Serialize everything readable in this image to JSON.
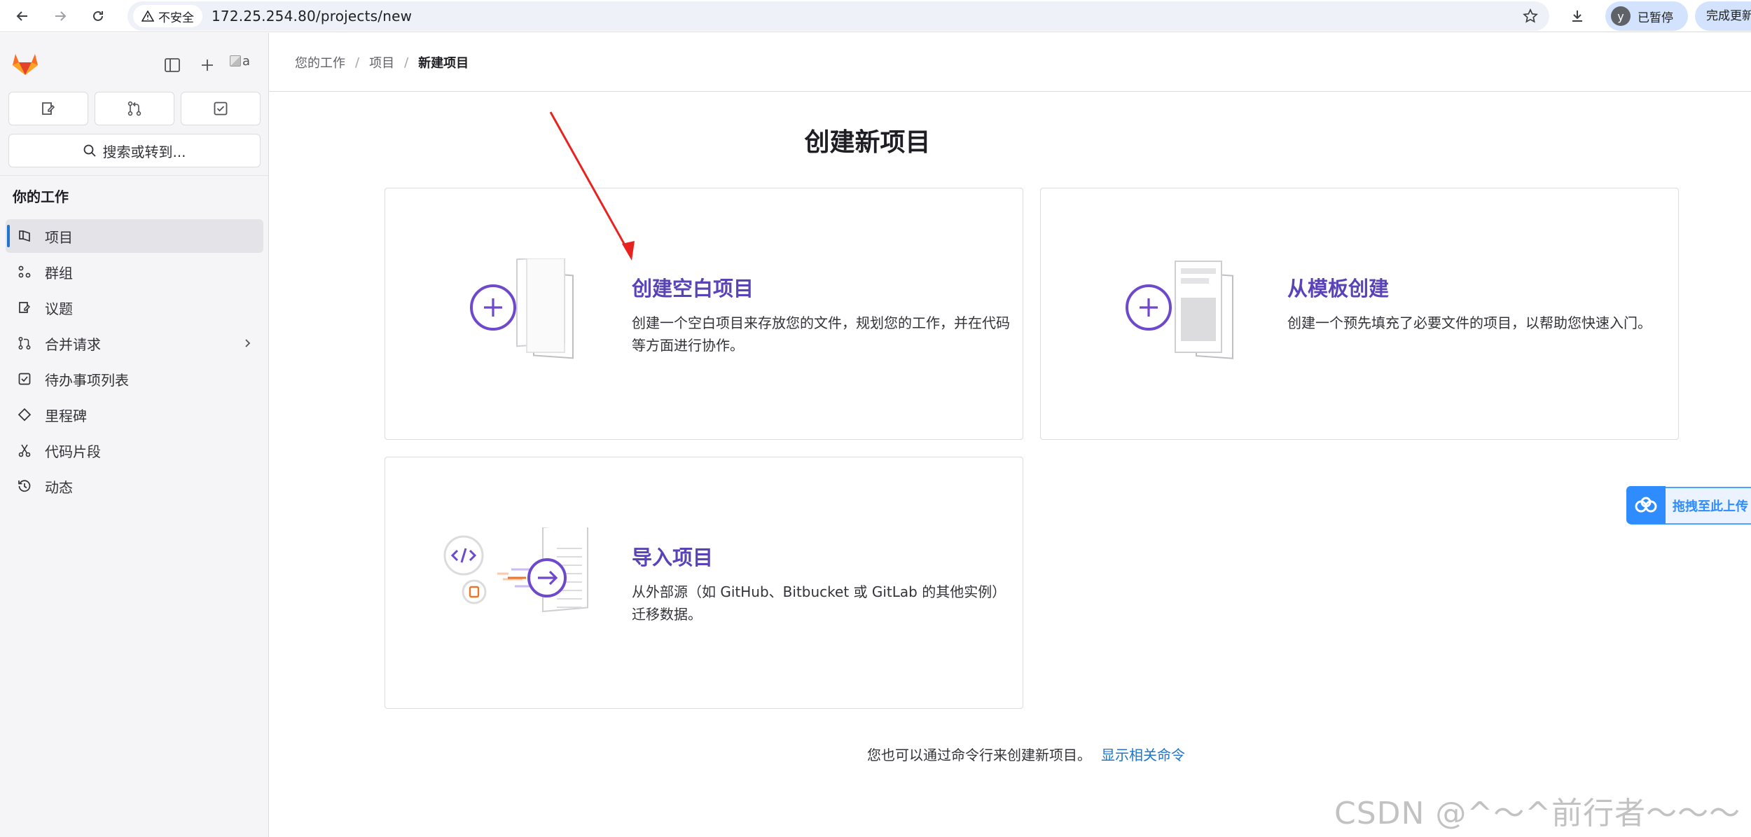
{
  "browser": {
    "security_label": "不安全",
    "url": "172.25.254.80/projects/new",
    "profile_initial": "y",
    "profile_status": "已暂停",
    "update_label": "完成更新"
  },
  "sidebar": {
    "avatar_alt": "a",
    "search_label": "搜索或转到...",
    "section_title": "你的工作",
    "items": [
      {
        "label": "项目",
        "icon": "project-icon",
        "active": true
      },
      {
        "label": "群组",
        "icon": "group-icon"
      },
      {
        "label": "议题",
        "icon": "issues-icon"
      },
      {
        "label": "合并请求",
        "icon": "merge-request-icon",
        "has_chevron": true
      },
      {
        "label": "待办事项列表",
        "icon": "todo-icon"
      },
      {
        "label": "里程碑",
        "icon": "milestone-icon"
      },
      {
        "label": "代码片段",
        "icon": "snippet-icon"
      },
      {
        "label": "动态",
        "icon": "activity-icon"
      }
    ]
  },
  "breadcrumb": {
    "items": [
      "您的工作",
      "项目",
      "新建项目"
    ]
  },
  "page": {
    "title": "创建新项目",
    "cards": [
      {
        "title": "创建空白项目",
        "description": "创建一个空白项目来存放您的文件，规划您的工作，并在代码等方面进行协作。"
      },
      {
        "title": "从模板创建",
        "description": "创建一个预先填充了必要文件的项目，以帮助您快速入门。"
      },
      {
        "title": "导入项目",
        "description": "从外部源（如 GitHub、Bitbucket 或 GitLab 的其他实例）迁移数据。"
      }
    ],
    "footer_text": "您也可以通过命令行来创建新项目。",
    "footer_link": "显示相关命令"
  },
  "overlay": {
    "pan_label": "拖拽至此上传",
    "watermark": "CSDN @^～^前行者～～～"
  },
  "colors": {
    "accent_purple": "#5943b6",
    "link_blue": "#1f75cb",
    "active_indicator": "#1f75cb",
    "annotation_red": "#e8231f"
  }
}
